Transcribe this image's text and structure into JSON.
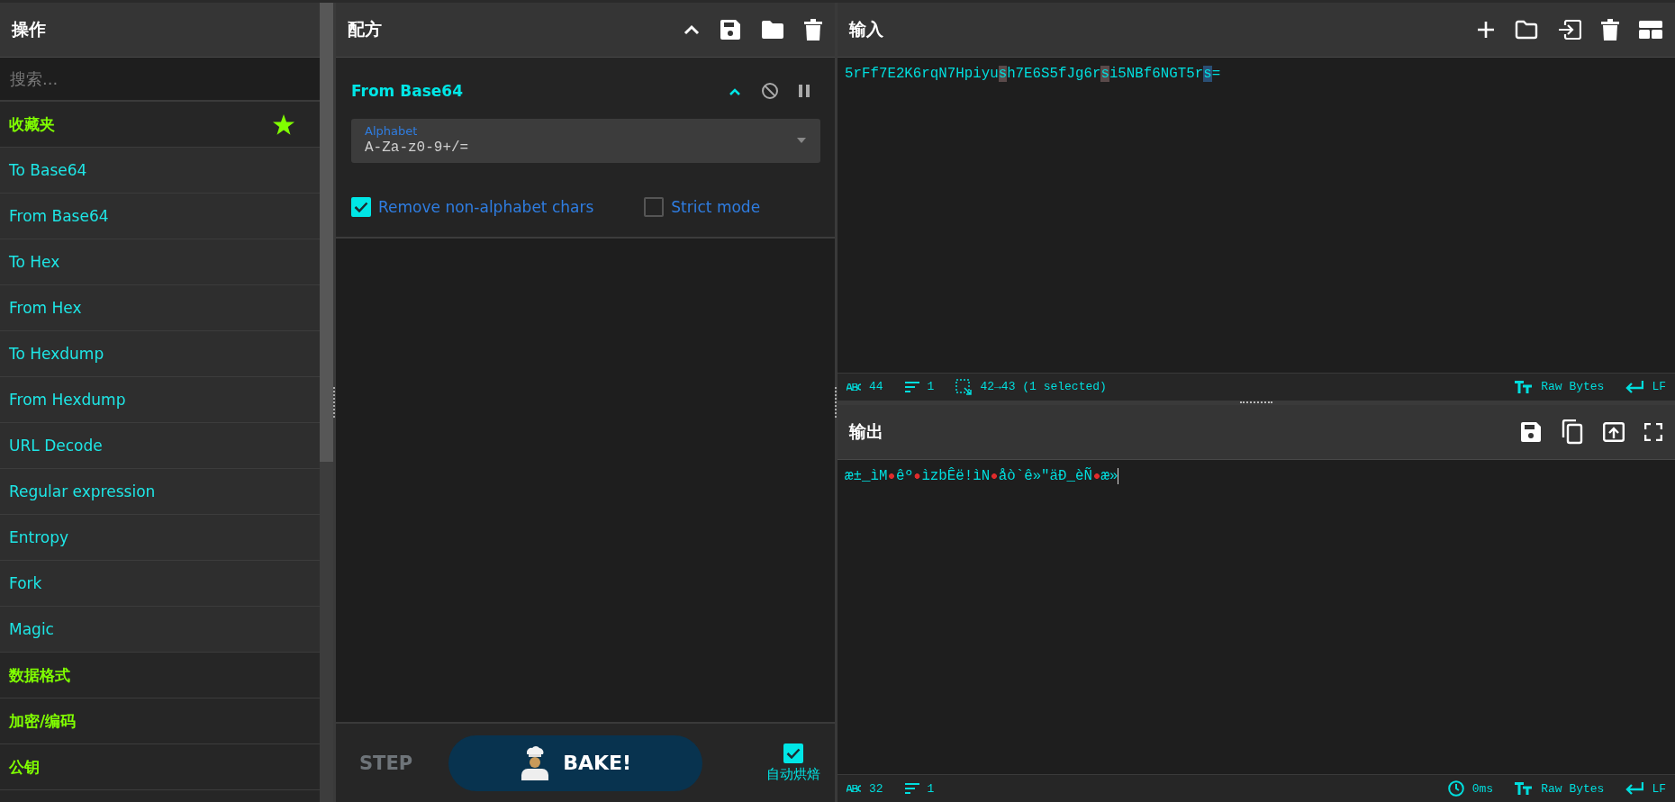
{
  "operations": {
    "title": "操作",
    "search_placeholder": "搜索...",
    "items": [
      {
        "kind": "favourites",
        "label": "收藏夹"
      },
      {
        "kind": "operation",
        "label": "To Base64"
      },
      {
        "kind": "operation",
        "label": "From Base64"
      },
      {
        "kind": "operation",
        "label": "To Hex"
      },
      {
        "kind": "operation",
        "label": "From Hex"
      },
      {
        "kind": "operation",
        "label": "To Hexdump"
      },
      {
        "kind": "operation",
        "label": "From Hexdump"
      },
      {
        "kind": "operation",
        "label": "URL Decode"
      },
      {
        "kind": "operation",
        "label": "Regular expression"
      },
      {
        "kind": "operation",
        "label": "Entropy"
      },
      {
        "kind": "operation",
        "label": "Fork"
      },
      {
        "kind": "operation",
        "label": "Magic"
      },
      {
        "kind": "category",
        "label": "数据格式"
      },
      {
        "kind": "category",
        "label": "加密/编码"
      },
      {
        "kind": "category",
        "label": "公钥"
      }
    ]
  },
  "recipe": {
    "title": "配方",
    "operation": {
      "name": "From Base64",
      "field": {
        "label": "Alphabet",
        "value": "A-Za-z0-9+/="
      },
      "options": [
        {
          "label": "Remove non-alphabet chars",
          "checked": true
        },
        {
          "label": "Strict mode",
          "checked": false
        }
      ]
    },
    "step": "STEP",
    "bake": "BAKE!",
    "auto_bake": {
      "label": "自动烘焙",
      "checked": true
    }
  },
  "input": {
    "title": "输入",
    "segments": [
      {
        "kind": "plain",
        "text": "5rFf7E2K6rqN7Hpiyu"
      },
      {
        "kind": "match",
        "text": "s"
      },
      {
        "kind": "plain",
        "text": "h7E6S5fJg6r"
      },
      {
        "kind": "match",
        "text": "s"
      },
      {
        "kind": "plain",
        "text": "i5NBf6NGT5r"
      },
      {
        "kind": "selected",
        "text": "s"
      },
      {
        "kind": "plain",
        "text": "="
      }
    ],
    "status": [
      {
        "kind": "chars",
        "text": "44"
      },
      {
        "kind": "lines",
        "text": "1"
      },
      {
        "kind": "selection",
        "text": "42→43 (1 selected)"
      }
    ],
    "status_right": [
      {
        "kind": "font",
        "text": "Raw Bytes"
      },
      {
        "kind": "eol",
        "text": "LF"
      }
    ]
  },
  "output": {
    "title": "输出",
    "segments": [
      {
        "kind": "plain",
        "text": "æ±_ìM"
      },
      {
        "kind": "control"
      },
      {
        "kind": "plain",
        "text": "êº"
      },
      {
        "kind": "control"
      },
      {
        "kind": "plain",
        "text": "ìzbÊë!ìN"
      },
      {
        "kind": "control"
      },
      {
        "kind": "plain",
        "text": "åò`ê»\"äÐ_èÑ"
      },
      {
        "kind": "control"
      },
      {
        "kind": "plain",
        "text": "æ»"
      }
    ],
    "status": [
      {
        "kind": "chars",
        "text": "32"
      },
      {
        "kind": "lines",
        "text": "1"
      }
    ],
    "status_right": [
      {
        "kind": "time",
        "text": "0ms"
      },
      {
        "kind": "font",
        "text": "Raw Bytes"
      },
      {
        "kind": "eol",
        "text": "LF"
      }
    ]
  }
}
